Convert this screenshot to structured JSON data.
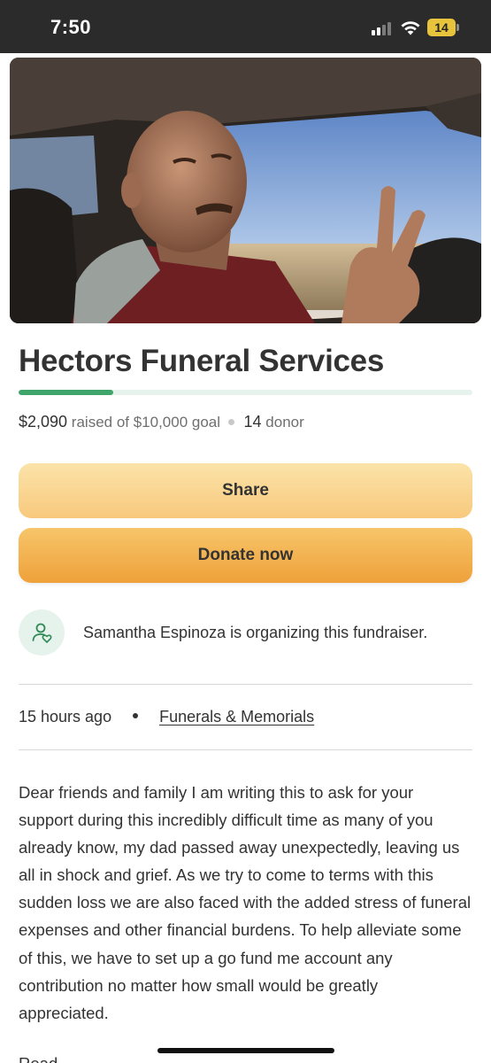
{
  "status_bar": {
    "time": "7:50",
    "battery_level": "14",
    "signal_icon": "signal-bars-icon",
    "wifi_icon": "wifi-icon",
    "battery_icon": "battery-icon"
  },
  "hero": {
    "image": "photo of a man in a vehicle making a peace sign"
  },
  "campaign": {
    "title": "Hectors Funeral Services",
    "raised": "$2,090",
    "raised_of_text": "raised of $10,000 goal",
    "donor_count": "14",
    "donor_label": "donor",
    "progress_fraction": 0.209
  },
  "buttons": {
    "share_label": "Share",
    "donate_label": "Donate now"
  },
  "organizer": {
    "icon": "user-heart-icon",
    "text": "Samantha Espinoza is organizing this fundraiser."
  },
  "meta": {
    "time_ago": "15 hours ago",
    "category": "Funerals & Memorials"
  },
  "story": {
    "body": "Dear friends and family I am writing this to ask for your support during this incredibly difficult time as many of you already know, my dad passed away unexpectedly, leaving us all in shock and grief. As we try to come to terms with this sudden loss we are also faced with the added stress of funeral expenses and other financial burdens. To help alleviate some of this, we have to set up a go fund me account any contribution no matter how small would be greatly appreciated.",
    "next_line_partial": "Read"
  },
  "colors": {
    "progress": "#3fa56a",
    "share_button": "#f8c97d",
    "donate_button": "#eea13a",
    "status_bar": "#2b2b2b"
  }
}
